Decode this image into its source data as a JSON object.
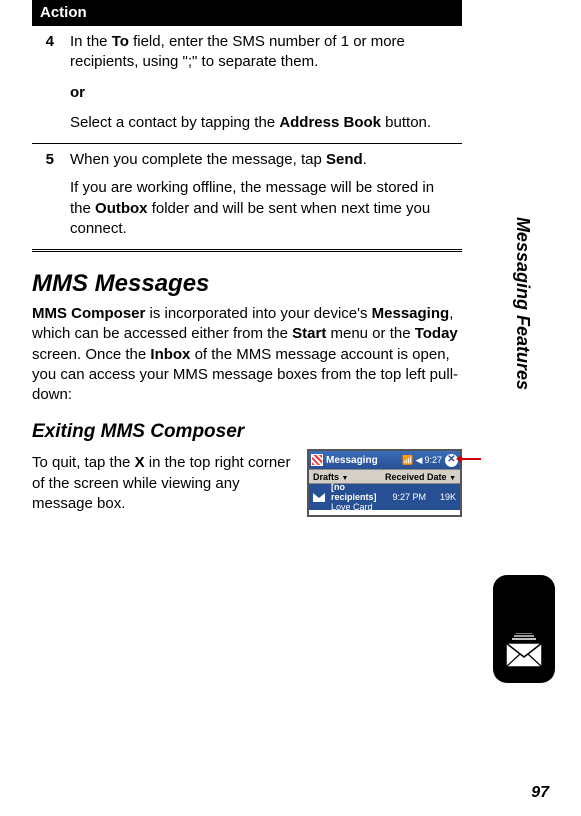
{
  "action_header": "Action",
  "steps": {
    "s4": {
      "num": "4",
      "line1a": "In the ",
      "line1b_ui": "To",
      "line1c": " field, enter the SMS number of 1 or more recipients, using \";\" to separate them.",
      "or": "or",
      "line2a": "Select a contact by tapping the ",
      "line2b_ui": "Address Book",
      "line2c": " button."
    },
    "s5": {
      "num": "5",
      "line1a": "When you complete the message, tap ",
      "line1b_ui": "Send",
      "line1c": ".",
      "line2a": "If you are working offline, the message will be stored in the ",
      "line2b_ui": "Outbox",
      "line2c": " folder and will be sent when next time you connect."
    }
  },
  "mms_heading": "MMS Messages",
  "mms_para": {
    "p1a_ui": "MMS Composer",
    "p1b": " is incorporated into your device's ",
    "p1c_ui": "Messaging",
    "p1d": ", which can be accessed either from the ",
    "p1e_ui": "Start",
    "p1f": " menu or the ",
    "p1g_ui": "Today",
    "p1h": " screen. Once the ",
    "p1i_ui": "Inbox",
    "p1j": " of the MMS message account is open, you can access your MMS message boxes from the top left pull-down:"
  },
  "exit_heading": "Exiting MMS Composer",
  "exit_para": {
    "a": "To quit, tap the ",
    "b_ui": "X",
    "c": " in the top right corner of the screen while viewing any message box."
  },
  "screenshot": {
    "title": "Messaging",
    "signal": "📶",
    "sound": "◀",
    "time": "9:27",
    "drafts": "Drafts",
    "received": "Received Date",
    "row_recip": "[no recipients]",
    "row_time": "9:27 PM",
    "row_size": "19K",
    "row_subject": "Love Card"
  },
  "side_text": "Messaging Features",
  "page_number": "97"
}
